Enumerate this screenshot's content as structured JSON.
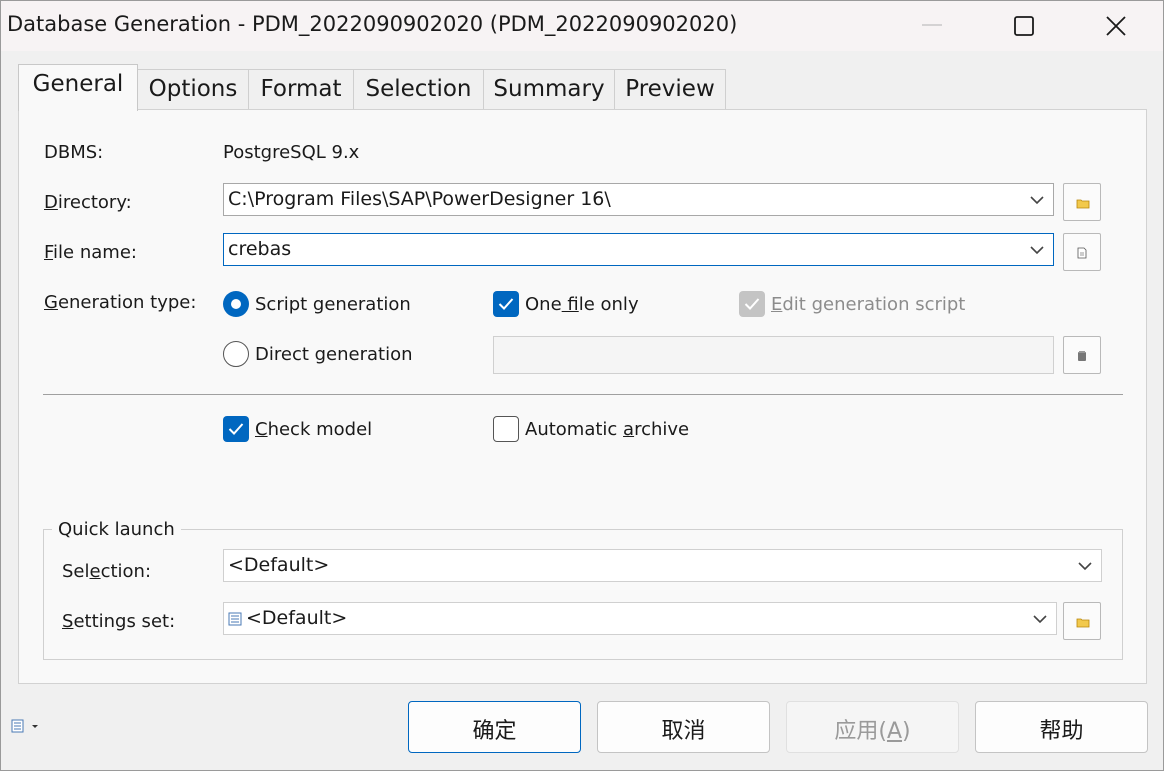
{
  "window": {
    "title": "Database Generation - PDM_2022090902020 (PDM_2022090902020)"
  },
  "tabs": [
    {
      "label": "General",
      "active": true
    },
    {
      "label": "Options"
    },
    {
      "label": "Format"
    },
    {
      "label": "Selection"
    },
    {
      "label": "Summary"
    },
    {
      "label": "Preview"
    }
  ],
  "general": {
    "dbms_label": "DBMS:",
    "dbms_value": "PostgreSQL 9.x",
    "directory_label_u": "D",
    "directory_label_rest": "irectory:",
    "directory_value": "C:\\Program Files\\SAP\\PowerDesigner 16\\",
    "filename_label_u": "F",
    "filename_label_rest": "ile name:",
    "filename_value": "crebas",
    "gentype_label_u": "G",
    "gentype_label_rest": "eneration type:",
    "script_generation": "Script generation",
    "direct_generation": "Direct generation",
    "one_file_only_pre": "One",
    "one_file_only_u": " f",
    "one_file_only_post": "ile only",
    "edit_script_u": "E",
    "edit_script_rest": "dit generation script",
    "check_model_u": "C",
    "check_model_rest": "heck model",
    "auto_archive_pre": "Automatic ",
    "auto_archive_u": "a",
    "auto_archive_post": "rchive"
  },
  "quick_launch": {
    "title": "Quick launch",
    "selection_label_pre": "Sel",
    "selection_label_u": "e",
    "selection_label_post": "ction:",
    "selection_value": "<Default>",
    "settings_label_u": "S",
    "settings_label_rest": "ettings set:",
    "settings_value": "<Default>"
  },
  "buttons": {
    "ok": "确定",
    "cancel": "取消",
    "apply_pre": "应用(",
    "apply_u": "A",
    "apply_post": ")",
    "help": "帮助"
  },
  "colors": {
    "accent": "#0067c0",
    "titlebar": "#f7f3f4",
    "panel": "#f9f9f9"
  }
}
